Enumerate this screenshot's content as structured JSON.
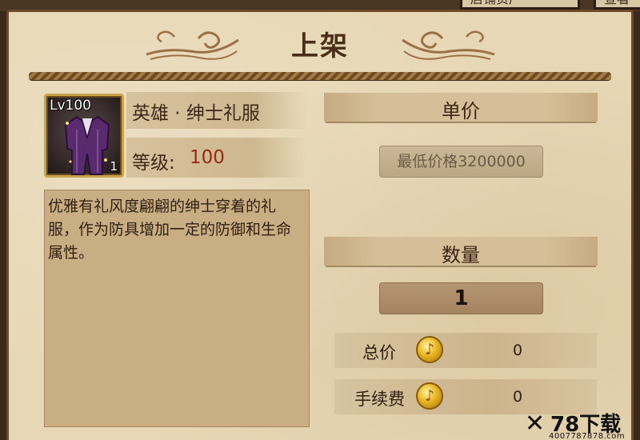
{
  "top_tabs": [
    "店铺资产",
    "查看"
  ],
  "title": "上架",
  "item": {
    "level_badge": "Lv100",
    "count": "1",
    "name": "英雄 · 绅士礼服",
    "level_label": "等级:",
    "level_value": "100",
    "description": "优雅有礼风度翩翩的绅士穿着的礼服，作为防具增加一定的防御和生命属性。"
  },
  "price_section": {
    "title": "单价",
    "field_text": "最低价格3200000"
  },
  "quantity_section": {
    "title": "数量",
    "value": "1"
  },
  "total": {
    "label": "总价",
    "value": "0"
  },
  "fee": {
    "label": "手续费",
    "value": "0"
  },
  "watermark": {
    "brand": "78下载",
    "url": "4007787878.com"
  },
  "icons": {
    "coin": "gold-coin-icon",
    "item": "gentleman-suit-icon"
  },
  "colors": {
    "panel_bg": "#e7d7b4",
    "level_value": "#9a2a12",
    "title": "#4a2e18"
  }
}
